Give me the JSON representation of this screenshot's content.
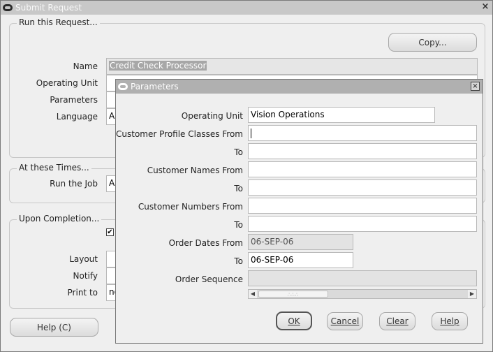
{
  "main_window": {
    "title": "Submit Request",
    "close_label": "×",
    "run_group": {
      "title": "Run this Request...",
      "copy_button": "Copy...",
      "fields": {
        "name_label": "Name",
        "name_value": "Credit Check Processor",
        "operating_unit_label": "Operating Unit",
        "parameters_label": "Parameters",
        "language_label": "Language",
        "language_value": "Ar"
      }
    },
    "times_group": {
      "title": "At these Times...",
      "run_job_label": "Run the Job",
      "run_job_value": "As"
    },
    "completion_group": {
      "title": "Upon Completion...",
      "checkbox_checked": true,
      "checkbox_glyph": "✔",
      "layout_label": "Layout",
      "notify_label": "Notify",
      "print_to_label": "Print to",
      "print_to_value": "no"
    },
    "help_button": "Help (C)"
  },
  "parameters_dialog": {
    "title": "Parameters",
    "close_label": "×",
    "fields": [
      {
        "label": "Operating Unit",
        "value": "Vision Operations",
        "readonly": false
      },
      {
        "label": "Customer Profile Classes From",
        "value": "",
        "readonly": false,
        "focused": true
      },
      {
        "label": "To",
        "value": "",
        "readonly": false
      },
      {
        "label": "Customer Names From",
        "value": "",
        "readonly": false
      },
      {
        "label": "To",
        "value": "",
        "readonly": false
      },
      {
        "label": "Customer Numbers From",
        "value": "",
        "readonly": false
      },
      {
        "label": "To",
        "value": "",
        "readonly": false
      },
      {
        "label": "Order Dates From",
        "value": "06-SEP-06",
        "readonly": true
      },
      {
        "label": "To",
        "value": "06-SEP-06",
        "readonly": false
      },
      {
        "label": "Order Sequence",
        "value": "",
        "readonly": true
      }
    ],
    "scroll_left": "◀",
    "scroll_right": "▶",
    "scroll_grip": "∴∴∴",
    "buttons": {
      "ok": "OK",
      "cancel": "Cancel",
      "clear": "Clear",
      "help": "Help"
    }
  }
}
